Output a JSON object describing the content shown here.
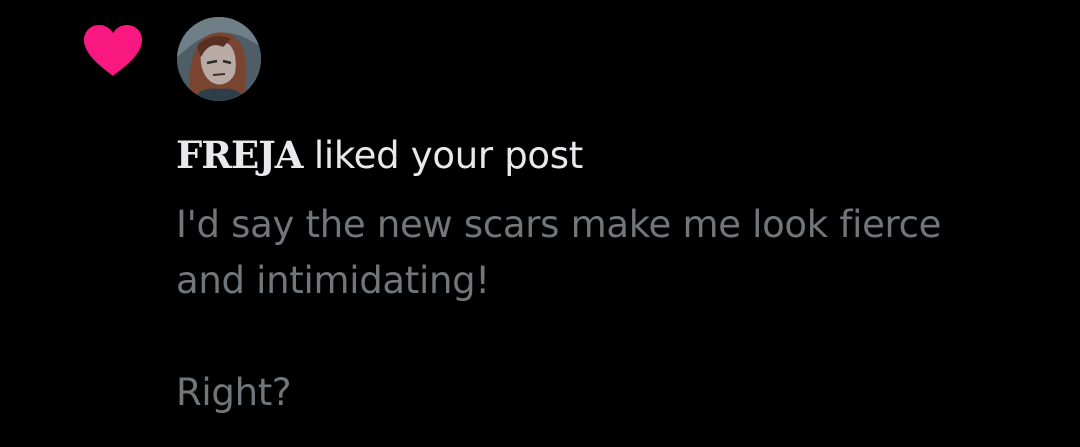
{
  "notification": {
    "type_icon": "heart-icon",
    "avatar_icon": "user-avatar",
    "username": "FREJA",
    "action": "liked your post",
    "post_lines": [
      "I'd say the new scars make me look fierce",
      "and intimidating!",
      "Right?"
    ]
  },
  "colors": {
    "background": "#000000",
    "heart": "#f91880",
    "primary_text": "#e7e9ea",
    "secondary_text": "#71767b"
  }
}
